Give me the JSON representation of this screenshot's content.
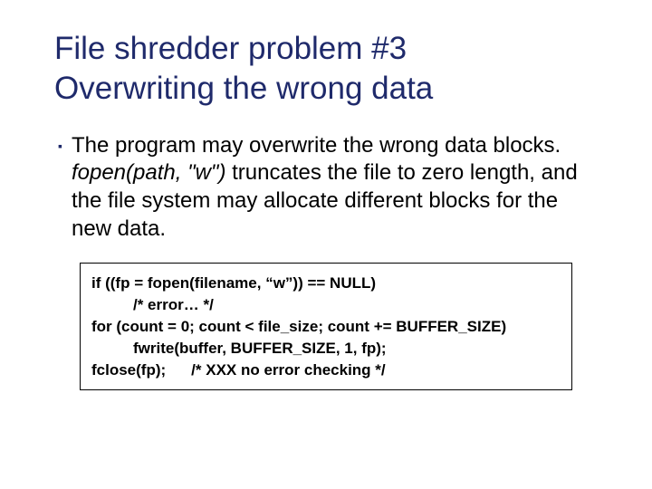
{
  "title_line1": "File shredder problem #3",
  "title_line2": "Overwriting the wrong data",
  "bullet": {
    "part1": "The program may overwrite the wrong data blocks. ",
    "italic": "fopen(path, \"w\")",
    "part2": " truncates the file to zero length, and the file system may allocate different blocks for the new data."
  },
  "code": {
    "l1": "if ((fp = fopen(filename, “w”)) == NULL)",
    "l2": "/* error… */",
    "l3": "for (count = 0; count < file_size; count += BUFFER_SIZE)",
    "l4": "fwrite(buffer, BUFFER_SIZE, 1, fp);",
    "l5a": "fclose(fp);",
    "l5b": "/* XXX no error checking */"
  }
}
